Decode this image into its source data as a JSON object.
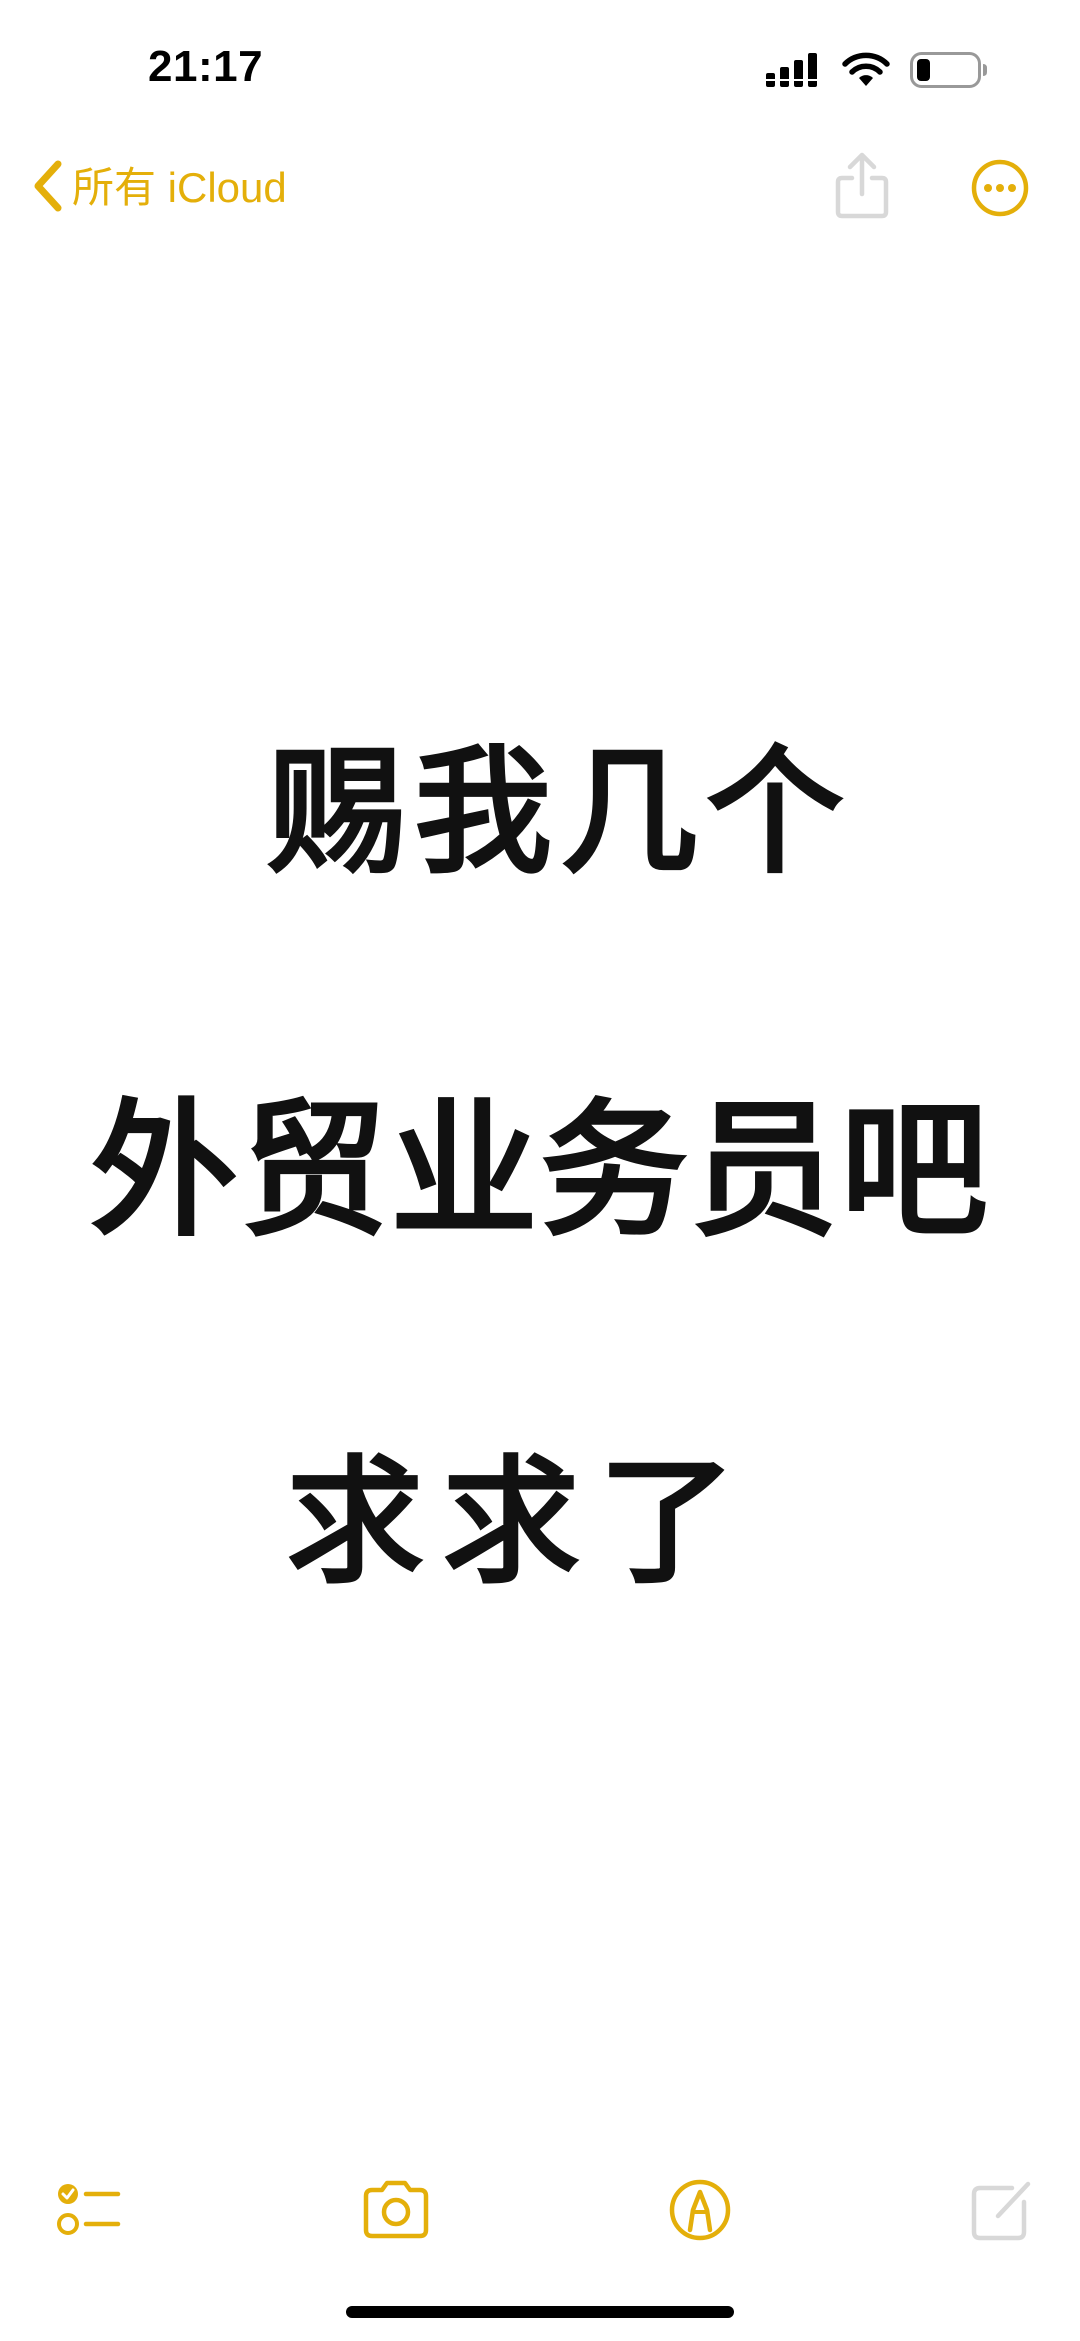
{
  "status_bar": {
    "time": "21:17",
    "icons": [
      "signal-icon",
      "wifi-icon",
      "battery-icon"
    ]
  },
  "nav": {
    "back_label": "所有 iCloud",
    "back_icon": "chevron-left-icon",
    "share_icon": "share-icon",
    "more_icon": "ellipsis-circle-icon"
  },
  "note": {
    "lines": [
      "赐我几个",
      "外贸业务员吧",
      "求求了"
    ]
  },
  "toolbar": {
    "items": [
      "checklist-icon",
      "camera-icon",
      "markup-icon",
      "compose-icon"
    ]
  },
  "colors": {
    "accent": "#E4AF0A",
    "accent_dim": "#D8D8D8",
    "text": "#111111",
    "background": "#FFFFFF"
  }
}
